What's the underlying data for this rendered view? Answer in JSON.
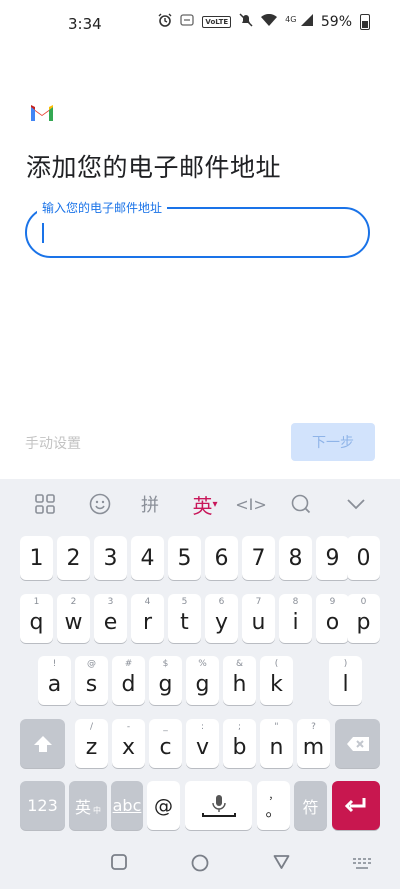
{
  "status_bar": {
    "time": "3:34",
    "network": "4G",
    "lte": "VoLTE",
    "battery": "59%"
  },
  "page": {
    "title": "添加您的电子邮件地址",
    "email_field": {
      "label": "输入您的电子邮件地址",
      "value": ""
    },
    "manual_setup": "手动设置",
    "next_button": "下一步"
  },
  "keyboard": {
    "toolbar": {
      "pinyin": "拼",
      "lang": "英",
      "lang_arrow": "▾",
      "cursor": "<I>"
    },
    "digits": [
      "1",
      "2",
      "3",
      "4",
      "5",
      "6",
      "7",
      "8",
      "9",
      "0"
    ],
    "row1": [
      {
        "hint": "1",
        "key": "q"
      },
      {
        "hint": "2",
        "key": "w"
      },
      {
        "hint": "3",
        "key": "e"
      },
      {
        "hint": "4",
        "key": "r"
      },
      {
        "hint": "5",
        "key": "t"
      },
      {
        "hint": "6",
        "key": "y"
      },
      {
        "hint": "7",
        "key": "u"
      },
      {
        "hint": "8",
        "key": "i"
      },
      {
        "hint": "9",
        "key": "o"
      },
      {
        "hint": "0",
        "key": "p"
      }
    ],
    "row2": [
      {
        "hint": "!",
        "key": "a"
      },
      {
        "hint": "@",
        "key": "s"
      },
      {
        "hint": "#",
        "key": "d"
      },
      {
        "hint": "$",
        "key": "g"
      },
      {
        "hint": "%",
        "key": "g"
      },
      {
        "hint": "&",
        "key": "h"
      },
      {
        "hint": "(",
        "key": "k"
      },
      {
        "hint": ")",
        "key": "l"
      }
    ],
    "row3": [
      {
        "hint": "/",
        "key": "z"
      },
      {
        "hint": "-",
        "key": "x"
      },
      {
        "hint": "_",
        "key": "c"
      },
      {
        "hint": ":",
        "key": "v"
      },
      {
        "hint": ";",
        "key": "b"
      },
      {
        "hint": "\"",
        "key": "n"
      },
      {
        "hint": "?",
        "key": "m"
      }
    ],
    "bottom": {
      "num": "123",
      "en": "英",
      "en_hint": "中",
      "abc": "abc",
      "at": "@",
      "comma": "，",
      "period": "。",
      "symbol": "符"
    }
  }
}
